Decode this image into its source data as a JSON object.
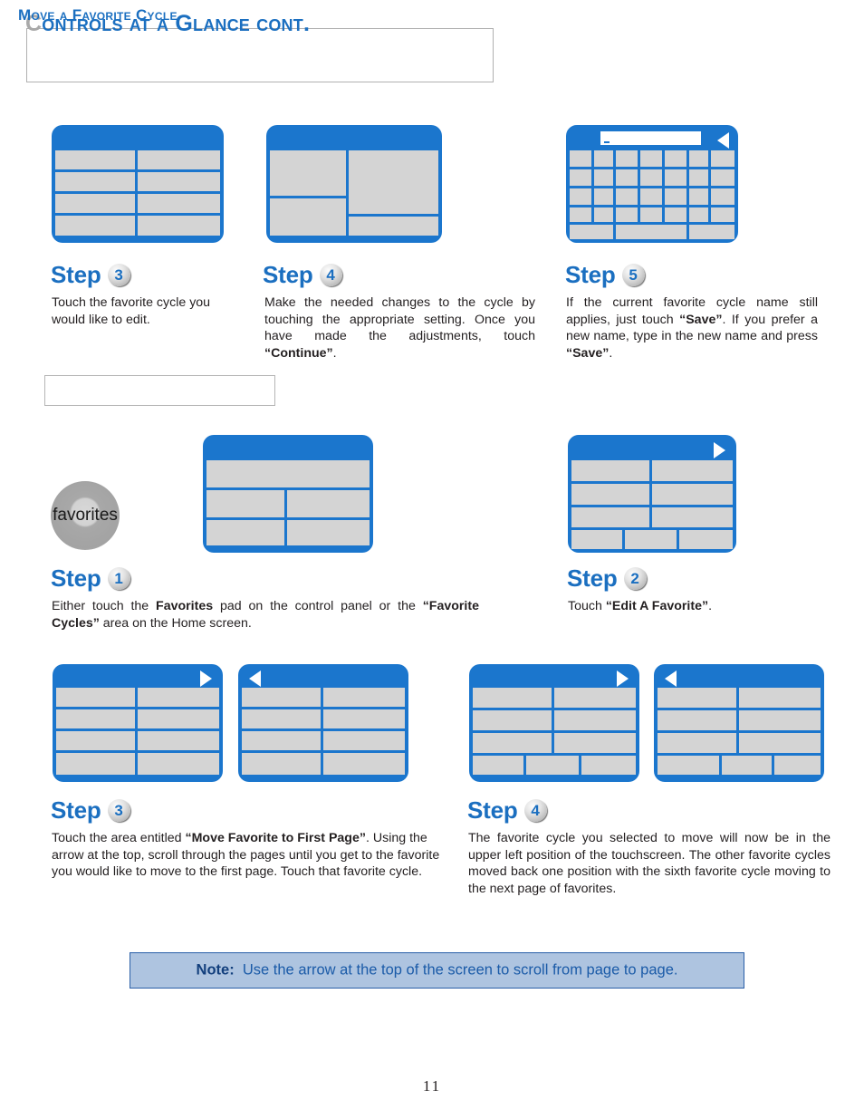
{
  "page": {
    "title_drop_cap": "C",
    "title_rest": "ontrols at a Glance cont.",
    "page_number": "11"
  },
  "section": {
    "heading": "Move a Favorite Cycle"
  },
  "controls": {
    "favorites_pad_label": "favorites"
  },
  "steps_top": [
    {
      "label": "Step",
      "number": "3",
      "text_html": "Touch the favorite cycle you would like to edit."
    },
    {
      "label": "Step",
      "number": "4",
      "text_html": "Make the needed changes to the cycle by touching the appropriate setting.  Once you have made the adjustments,  touch <b>&ldquo;Continue&rdquo;</b>."
    },
    {
      "label": "Step",
      "number": "5",
      "text_html": "If the current favorite cycle name still applies, just touch <b>&ldquo;Save&rdquo;</b>.  If you prefer a new name, type in the new name and press <b>&ldquo;Save&rdquo;</b>."
    }
  ],
  "steps_mid": [
    {
      "label": "Step",
      "number": "1",
      "text_html": "Either touch the <b>Favorites</b> pad on the control panel or the <b>&ldquo;Favorite Cycles&rdquo;</b> area on the Home screen."
    },
    {
      "label": "Step",
      "number": "2",
      "text_html": "Touch <b>&ldquo;Edit A Favorite&rdquo;</b>."
    }
  ],
  "steps_bottom": [
    {
      "label": "Step",
      "number": "3",
      "text_html": "Touch the area entitled <b>&ldquo;Move Favorite to First Page&rdquo;</b>. Using the arrow at the top, scroll through the pages until you get to the favorite you would like to move to the first page. Touch that favorite cycle."
    },
    {
      "label": "Step",
      "number": "4",
      "text_html": "The favorite cycle you selected to move will now be in the upper left position of the touchscreen. The other favorite cycles moved back one position with the sixth favorite cycle moving to the next page of favorites."
    }
  ],
  "note": {
    "label": "Note:",
    "text": "Use the arrow at the top of the screen to scroll from page to page."
  },
  "colors": {
    "screen_blue": "#1b76cd",
    "screen_cell_gray": "#d4d4d4",
    "heading_blue": "#1b6fc0",
    "note_background": "#aec4e0",
    "note_border": "#2a5fa8",
    "note_text": "#1b5ba8"
  },
  "screens": {
    "step3_top": {
      "name": "favorite-cycle-list-screen",
      "arrow": "none"
    },
    "step4_top": {
      "name": "cycle-settings-screen",
      "arrow": "none"
    },
    "step5_top": {
      "name": "keyboard-name-entry-screen",
      "arrow": "left",
      "has_text_field": true
    },
    "step1_mid": {
      "name": "home-screen",
      "arrow": "none"
    },
    "step2_mid": {
      "name": "favorites-menu-screen",
      "arrow": "right"
    },
    "step3_a": {
      "name": "favorites-page-one-screen",
      "arrow": "right"
    },
    "step3_b": {
      "name": "favorites-page-two-screen",
      "arrow": "left"
    },
    "step4_a": {
      "name": "favorites-reordered-page-one-screen",
      "arrow": "right"
    },
    "step4_b": {
      "name": "favorites-reordered-page-two-screen",
      "arrow": "left"
    }
  }
}
